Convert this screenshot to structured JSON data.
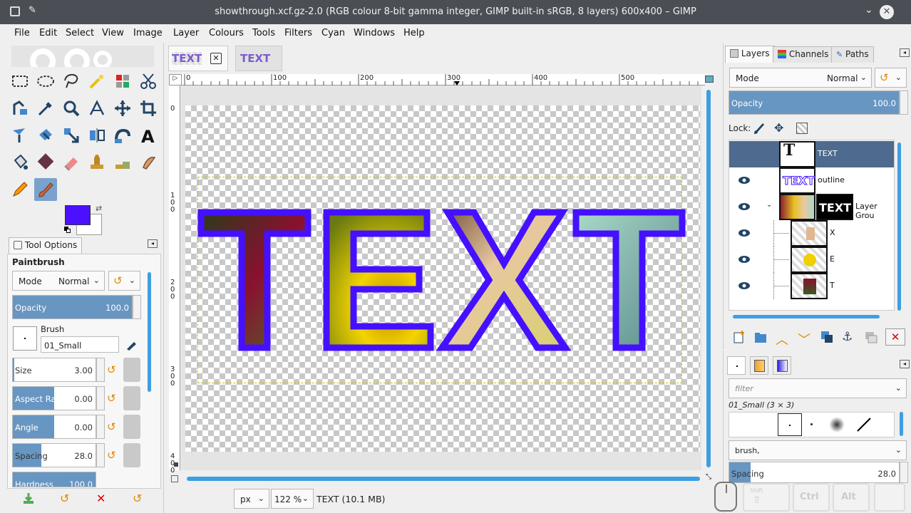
{
  "window": {
    "title": "showthrough.xcf.gz-2.0 (RGB colour 8-bit gamma integer, GIMP built-in sRGB, 8 layers) 600x400 – GIMP"
  },
  "menu": [
    "File",
    "Edit",
    "Select",
    "View",
    "Image",
    "Layer",
    "Colours",
    "Tools",
    "Filters",
    "Cyan",
    "Windows",
    "Help"
  ],
  "image_tabs": [
    "TEXT",
    "TEXT"
  ],
  "ruler": {
    "h_ticks": [
      "0",
      "100",
      "200",
      "300",
      "400",
      "500"
    ],
    "v_ticks": [
      "0",
      "100",
      "200",
      "300",
      "400"
    ]
  },
  "canvas": {
    "text": "TEXT",
    "outline_color": "#3f10ff"
  },
  "toolbox": {
    "fg_color": "#4a10ff",
    "bg_color": "#ffffff"
  },
  "tool_options": {
    "tab_label": "Tool Options",
    "tool_name": "Paintbrush",
    "mode_label": "Mode",
    "mode_value": "Normal",
    "opacity_label": "Opacity",
    "opacity_value": "100.0",
    "brush_label": "Brush",
    "brush_value": "01_Small",
    "size_label": "Size",
    "size_value": "3.00",
    "aspect_label": "Aspect Ratio",
    "aspect_value": "0.00",
    "angle_label": "Angle",
    "angle_value": "0.00",
    "spacing_label": "Spacing",
    "spacing_value": "28.0",
    "hardness_label": "Hardness",
    "hardness_value": "100.0"
  },
  "status": {
    "unit": "px",
    "zoom": "122 %",
    "info": "TEXT (10.1 MB)"
  },
  "layers_panel": {
    "tabs": [
      "Layers",
      "Channels",
      "Paths"
    ],
    "mode_label": "Mode",
    "mode_value": "Normal",
    "opacity_label": "Opacity",
    "opacity_value": "100.0",
    "lock_label": "Lock:",
    "layers": [
      {
        "name": "TEXT",
        "selected": true
      },
      {
        "name": "outline",
        "selected": false
      },
      {
        "name": "Layer Grou",
        "selected": false
      },
      {
        "name": "X",
        "selected": false
      },
      {
        "name": "E",
        "selected": false
      },
      {
        "name": "T",
        "selected": false
      }
    ]
  },
  "brushes_panel": {
    "filter_placeholder": "filter",
    "brush_title": "01_Small (3 × 3)",
    "tag_value": "brush,",
    "spacing_label": "Spacing",
    "spacing_value": "28.0"
  },
  "modifier_keys": [
    "Shift",
    "Ctrl",
    "Alt"
  ]
}
